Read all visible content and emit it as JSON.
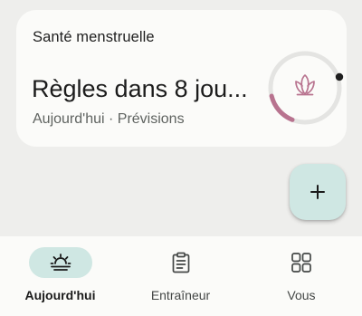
{
  "card": {
    "title": "Santé menstruelle",
    "headline": "Règles dans 8 jou...",
    "subtitle": "Aujourd'hui · Prévisions",
    "icon": "lotus-icon",
    "accent_color": "#b8738f"
  },
  "fab": {
    "icon": "plus-icon"
  },
  "bottom_nav": {
    "items": [
      {
        "label": "Aujourd'hui",
        "icon": "sunrise-icon",
        "active": true
      },
      {
        "label": "Entraîneur",
        "icon": "clipboard-icon",
        "active": false
      },
      {
        "label": "Vous",
        "icon": "grid-icon",
        "active": false
      }
    ]
  },
  "colors": {
    "background": "#eeeeec",
    "card": "#fbfbf9",
    "pill": "#cfe7e3",
    "ring_track": "#e4e4e2",
    "ring_accent": "#b8738f"
  }
}
